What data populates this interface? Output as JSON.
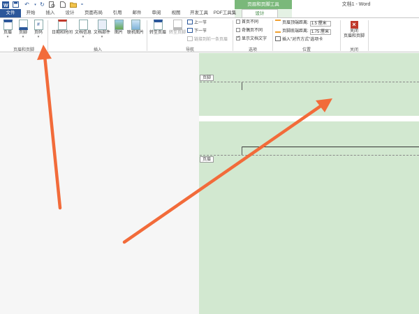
{
  "window": {
    "doc_title": "文档1 - Word",
    "context_title": "页眉和页脚工具"
  },
  "tabs": [
    {
      "label": "文件"
    },
    {
      "label": "开始"
    },
    {
      "label": "插入"
    },
    {
      "label": "设计"
    },
    {
      "label": "页面布局"
    },
    {
      "label": "引用"
    },
    {
      "label": "邮件"
    },
    {
      "label": "审阅"
    },
    {
      "label": "视图"
    },
    {
      "label": "开发工具"
    },
    {
      "label": "PDF工具集"
    },
    {
      "label": "设计"
    }
  ],
  "ribbon": {
    "hf_group": {
      "label": "页眉和页脚",
      "header": "页眉",
      "footer": "页脚",
      "page_number": "页码"
    },
    "insert_group": {
      "label": "插入",
      "datetime": "日期和时间",
      "docinfo": "文档信息",
      "docparts": "文档部件",
      "picture": "图片",
      "online_picture": "联机图片"
    },
    "nav_group": {
      "label": "导航",
      "goto_header": "转至页眉",
      "goto_footer": "转至页脚",
      "prev": "上一节",
      "next": "下一节",
      "link_prev": "链接到前一条页眉"
    },
    "options_group": {
      "label": "选项",
      "first_page": "首页不同",
      "odd_even": "奇偶页不同",
      "show_text": "显示文档文字"
    },
    "position_group": {
      "label": "位置",
      "header_top_label": "页眉顶端距离:",
      "header_top_value": "1.5 厘米",
      "footer_bottom_label": "页脚底端距离:",
      "footer_bottom_value": "1.75 厘米",
      "insert_tab": "插入\"对齐方式\"选项卡"
    },
    "close_group": {
      "label": "关闭",
      "close_line1": "关闭",
      "close_line2": "页眉和页脚"
    }
  },
  "document": {
    "footer_tag": "页脚",
    "header_tag": "页眉"
  },
  "colors": {
    "word_blue": "#2b579a",
    "context_green": "#7ab87a",
    "page_green": "#d2e8d0",
    "arrow": "#f26b3a"
  }
}
